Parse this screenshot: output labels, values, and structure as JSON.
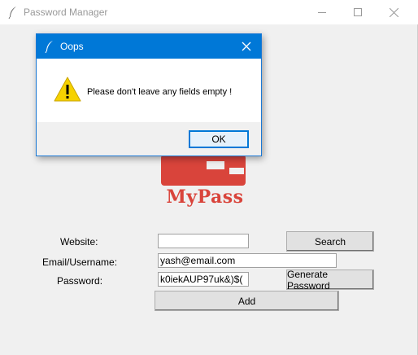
{
  "main_window": {
    "title": "Password Manager"
  },
  "logo": {
    "text": "MyPass",
    "color": "#d9443b"
  },
  "form": {
    "website_label": "Website:",
    "website_value": "",
    "email_label": "Email/Username:",
    "email_value": "yash@email.com",
    "password_label": "Password:",
    "password_value": "k0iekAUP97uk&)$(",
    "search_button": "Search",
    "generate_button": "Generate Password",
    "add_button": "Add"
  },
  "dialog": {
    "title": "Oops",
    "message": "Please don't leave any fields empty !",
    "ok_label": "OK",
    "accent": "#0078d7"
  }
}
